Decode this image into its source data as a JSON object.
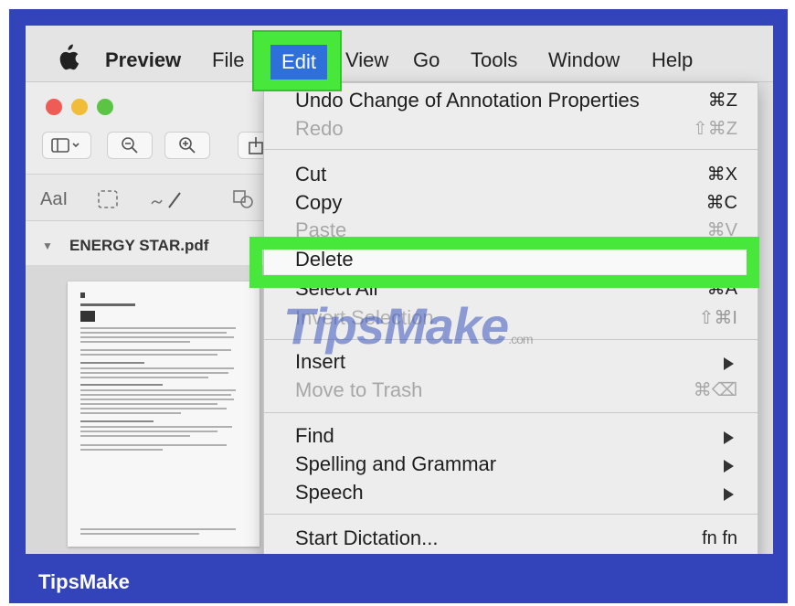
{
  "menubar": {
    "app": "Preview",
    "items": [
      "File",
      "Edit",
      "View",
      "Go",
      "Tools",
      "Window",
      "Help"
    ]
  },
  "sidebar": {
    "document_name": "ENERGY STAR.pdf"
  },
  "toolbar": {
    "text_tool": "AaI"
  },
  "edit_menu": {
    "undo": {
      "label": "Undo Change of Annotation Properties",
      "shortcut": "⌘Z"
    },
    "redo": {
      "label": "Redo",
      "shortcut": "⇧⌘Z"
    },
    "cut": {
      "label": "Cut",
      "shortcut": "⌘X"
    },
    "copy": {
      "label": "Copy",
      "shortcut": "⌘C"
    },
    "paste": {
      "label": "Paste",
      "shortcut": "⌘V"
    },
    "delete": {
      "label": "Delete"
    },
    "select_all": {
      "label": "Select All",
      "shortcut": "⌘A"
    },
    "invert_selection": {
      "label": "Invert Selection",
      "shortcut": "⇧⌘I"
    },
    "insert": {
      "label": "Insert"
    },
    "move_to_trash": {
      "label": "Move to Trash",
      "shortcut": "⌘⌫"
    },
    "find": {
      "label": "Find"
    },
    "spelling": {
      "label": "Spelling and Grammar"
    },
    "speech": {
      "label": "Speech"
    },
    "dictation": {
      "label": "Start Dictation...",
      "shortcut": "fn fn"
    }
  },
  "watermark": {
    "text": "TipsMake",
    "suffix": ".com"
  },
  "brand": {
    "text": "TipsMake"
  },
  "colors": {
    "frame": "#3344bb",
    "highlight_green": "#47e83b",
    "selected_blue": "#2e6fd9"
  }
}
